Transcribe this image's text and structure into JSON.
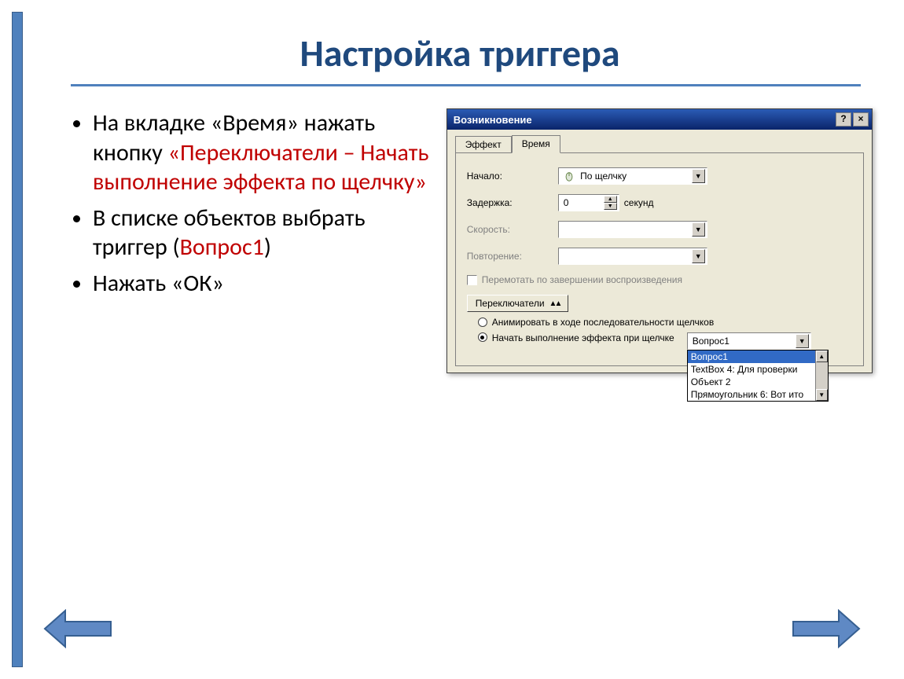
{
  "slide": {
    "title": "Настройка триггера",
    "bullets": [
      {
        "pre": "На вкладке «Время» нажать кнопку ",
        "red": "«Переключатели – Начать выполнение эффекта по щелчку»"
      },
      {
        "pre": "В списке объектов выбрать триггер (",
        "red": "Вопрос1",
        "post": ")"
      },
      {
        "pre": "Нажать «ОК»"
      }
    ]
  },
  "dialog": {
    "title": "Возникновение",
    "tabs": {
      "effect": "Эффект",
      "time": "Время"
    },
    "labels": {
      "start": "Начало:",
      "delay": "Задержка:",
      "speed": "Скорость:",
      "repeat": "Повторение:",
      "seconds": "секунд",
      "rewind": "Перемотать по завершении воспроизведения",
      "toggles_btn": "Переключатели",
      "radio_seq": "Анимировать в ходе последовательности щелчков",
      "radio_click": "Начать выполнение эффекта при щелчке"
    },
    "values": {
      "start": "По щелчку",
      "delay": "0",
      "speed": "",
      "repeat": "",
      "click_target": "Вопрос1"
    },
    "dropdown_items": [
      "Вопрос1",
      "TextBox 4: Для проверки",
      "Объект 2",
      "Прямоугольник 6: Вот ито"
    ]
  }
}
